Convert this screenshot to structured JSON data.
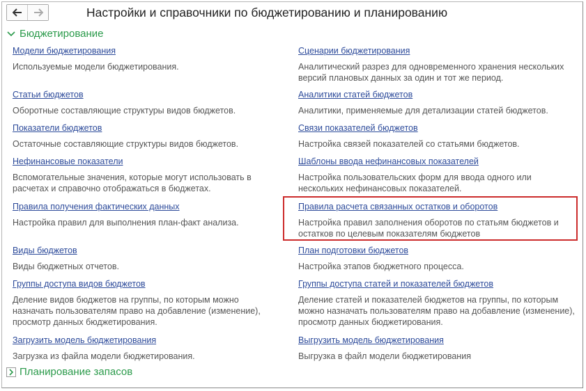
{
  "window": {
    "title": "Настройки и справочники по бюджетированию и планированию",
    "nav": {
      "back": "back-arrow",
      "forward": "forward-arrow"
    }
  },
  "groups": [
    {
      "title": "Бюджетирование",
      "expanded": true,
      "left": [
        {
          "link": "Модели бюджетирования",
          "desc": "Используемые модели бюджетирования."
        },
        {
          "link": "Статьи бюджетов",
          "desc": "Оборотные составляющие структуры видов бюджетов."
        },
        {
          "link": "Показатели бюджетов",
          "desc": "Остаточные составляющие структуры видов бюджетов."
        },
        {
          "link": "Нефинансовые показатели",
          "desc": "Вспомогательные значения, которые могут использовать в расчетах и справочно отображаться в бюджетах."
        },
        {
          "link": "Правила получения фактических данных",
          "desc": "Настройка правил для выполнения план-факт анализа."
        },
        {
          "link": "Виды бюджетов",
          "desc": "Виды бюджетных отчетов."
        },
        {
          "link": "Группы доступа видов бюджетов",
          "desc": "Деление видов бюджетов на группы, по которым можно назначать пользователям право на добавление (изменение), просмотр данных бюджетирования."
        },
        {
          "link": "Загрузить модель бюджетирования",
          "desc": "Загрузка из файла модели бюджетирования."
        }
      ],
      "right": [
        {
          "link": "Сценарии бюджетирования",
          "desc": "Аналитический разрез для одновременного хранения нескольких версий плановых данных за один и тот же период."
        },
        {
          "link": "Аналитики статей бюджетов",
          "desc": "Аналитики, применяемые для детализации статей бюджетов."
        },
        {
          "link": "Связи показателей бюджетов",
          "desc": "Настройка связей показателей со статьями бюджетов."
        },
        {
          "link": "Шаблоны ввода нефинансовых показателей",
          "desc": "Настройка пользовательских форм для ввода одного или нескольких нефинансовых показателей."
        },
        {
          "link": "Правила расчета связанных остатков и оборотов",
          "desc": "Настройка правил заполнения оборотов по статьям бюджетов и остатков по целевым показателям бюджетов"
        },
        {
          "link": "План подготовки бюджетов",
          "desc": "Настройка этапов бюджетного процесса."
        },
        {
          "link": "Группы доступа статей и показателей бюджетов",
          "desc": "Деление статей и показателей бюджетов на группы, по которым можно назначать пользователям право на добавление (изменение), просмотр данных бюджетирования."
        },
        {
          "link": "Выгрузить модель бюджетирования",
          "desc": "Выгрузка в файл модели бюджетирования"
        }
      ]
    },
    {
      "title": "Планирование запасов",
      "expanded": false
    }
  ],
  "colors": {
    "link": "#2c4a9a",
    "group": "#2a9a4a",
    "highlight": "#cc2b2b"
  }
}
